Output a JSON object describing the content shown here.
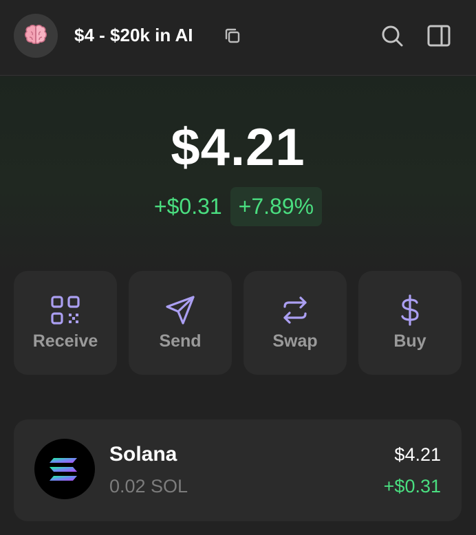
{
  "header": {
    "wallet_name": "$4 - $20k in AI",
    "avatar_icon": "brain-icon",
    "copy_icon": "copy-icon",
    "search_icon": "search-icon",
    "sidebar_icon": "sidebar-toggle-icon"
  },
  "portfolio": {
    "balance": "$4.21",
    "change_amount": "+$0.31",
    "change_percent": "+7.89%"
  },
  "actions": [
    {
      "label": "Receive",
      "icon": "qr-code-icon"
    },
    {
      "label": "Send",
      "icon": "send-icon"
    },
    {
      "label": "Swap",
      "icon": "swap-icon"
    },
    {
      "label": "Buy",
      "icon": "dollar-icon"
    }
  ],
  "tokens": [
    {
      "name": "Solana",
      "amount": "0.02 SOL",
      "value": "$4.21",
      "change": "+$0.31",
      "icon": "solana-logo-icon"
    }
  ],
  "colors": {
    "background": "#222222",
    "accent_purple": "#ab9ff2",
    "positive_green": "#4ade80",
    "card": "#2b2b2b"
  }
}
